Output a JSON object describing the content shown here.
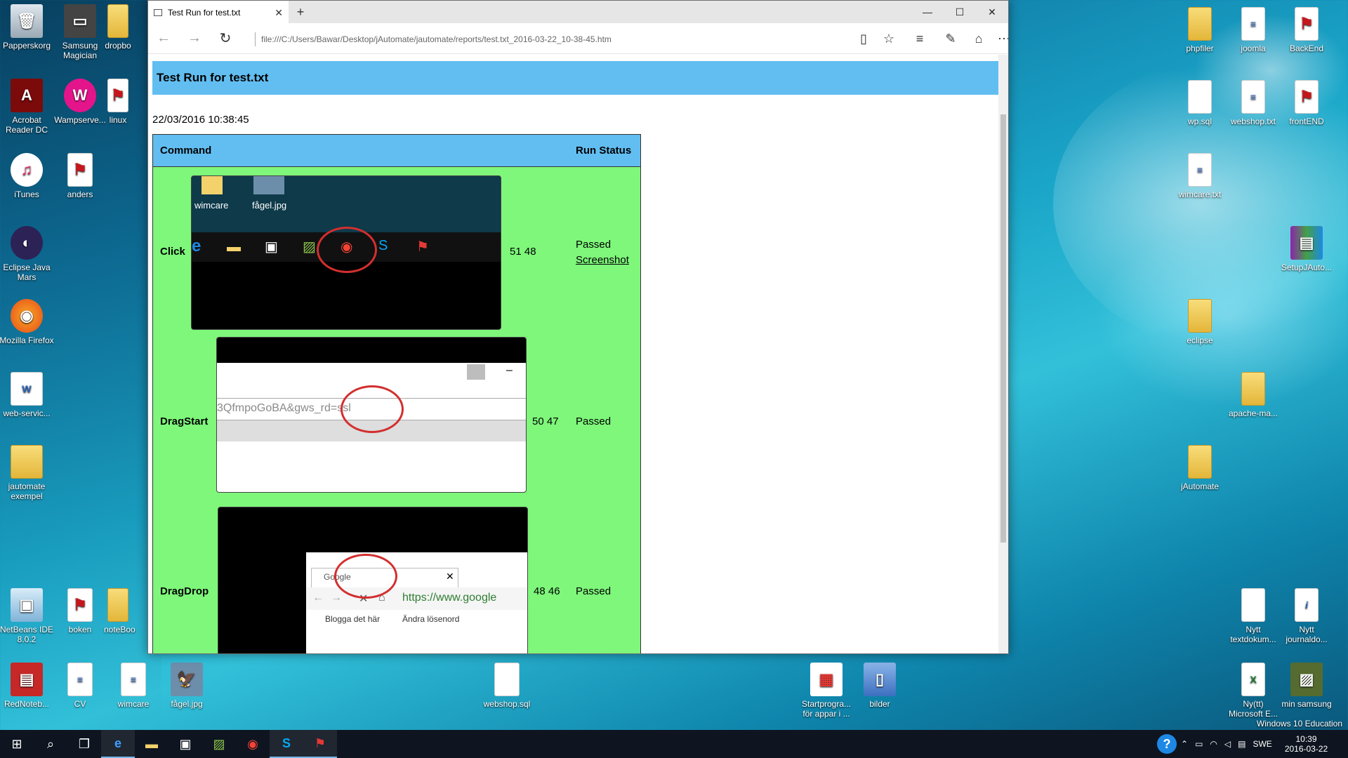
{
  "desktop": {
    "left_icons": [
      "Papperskorg",
      "Samsung Magician",
      "dropbo",
      "Acrobat Reader DC",
      "Wampserve...",
      "linux",
      "iTunes",
      "anders",
      "Eclipse Java Mars",
      "Mozilla Firefox",
      "web-servic...",
      "jautomate exempel",
      "NetBeans IDE 8.0.2",
      "boken",
      "noteBoo",
      "RedNoteb...",
      "CV",
      "wimcare",
      "fågel.jpg"
    ],
    "center_icons": [
      "webshop.sql",
      "Startprogra... för appar i ...",
      "bilder"
    ],
    "right_icons": [
      "phpfiler",
      "joomla",
      "BackEnd",
      "wp.sql",
      "webshop.txt",
      "frontEND",
      "wimcare.txt",
      "SetupJAuto...",
      "eclipse",
      "apache-ma...",
      "jAutomate",
      "Nytt textdokum...",
      "Nytt journaldo...",
      "Ny(tt) Microsoft E...",
      "min samsung"
    ],
    "watermark": "Windows 10 Education"
  },
  "browser": {
    "tab_title": "Test Run for test.txt",
    "address": "file:///C:/Users/Bawar/Desktop/jAutomate/jautomate/reports/test.txt_2016-03-22_10-38-45.htm"
  },
  "report": {
    "title": "Test Run for test.txt",
    "date": "22/03/2016 10:38:45",
    "headers": {
      "command": "Command",
      "status": "Run Status"
    },
    "rows": [
      {
        "command": "Click",
        "coords": "51 48",
        "status": "Passed",
        "link": "Screenshot"
      },
      {
        "command": "DragStart",
        "coords": "50 47",
        "status": "Passed"
      },
      {
        "command": "DragDrop",
        "coords": "48 46",
        "status": "Passed"
      }
    ],
    "shot1": {
      "icon1": "wimcare",
      "icon2": "fågel.jpg"
    },
    "shot2": {
      "url_text": "3QfmpoGoBA&gws_rd=ssl"
    },
    "shot3": {
      "tab": "Google",
      "url": "https://www.google",
      "bm1": "Blogga det här",
      "bm2": "Ändra lösenord"
    }
  },
  "taskbar": {
    "lang": "SWE",
    "time": "10:39",
    "date": "2016-03-22"
  }
}
